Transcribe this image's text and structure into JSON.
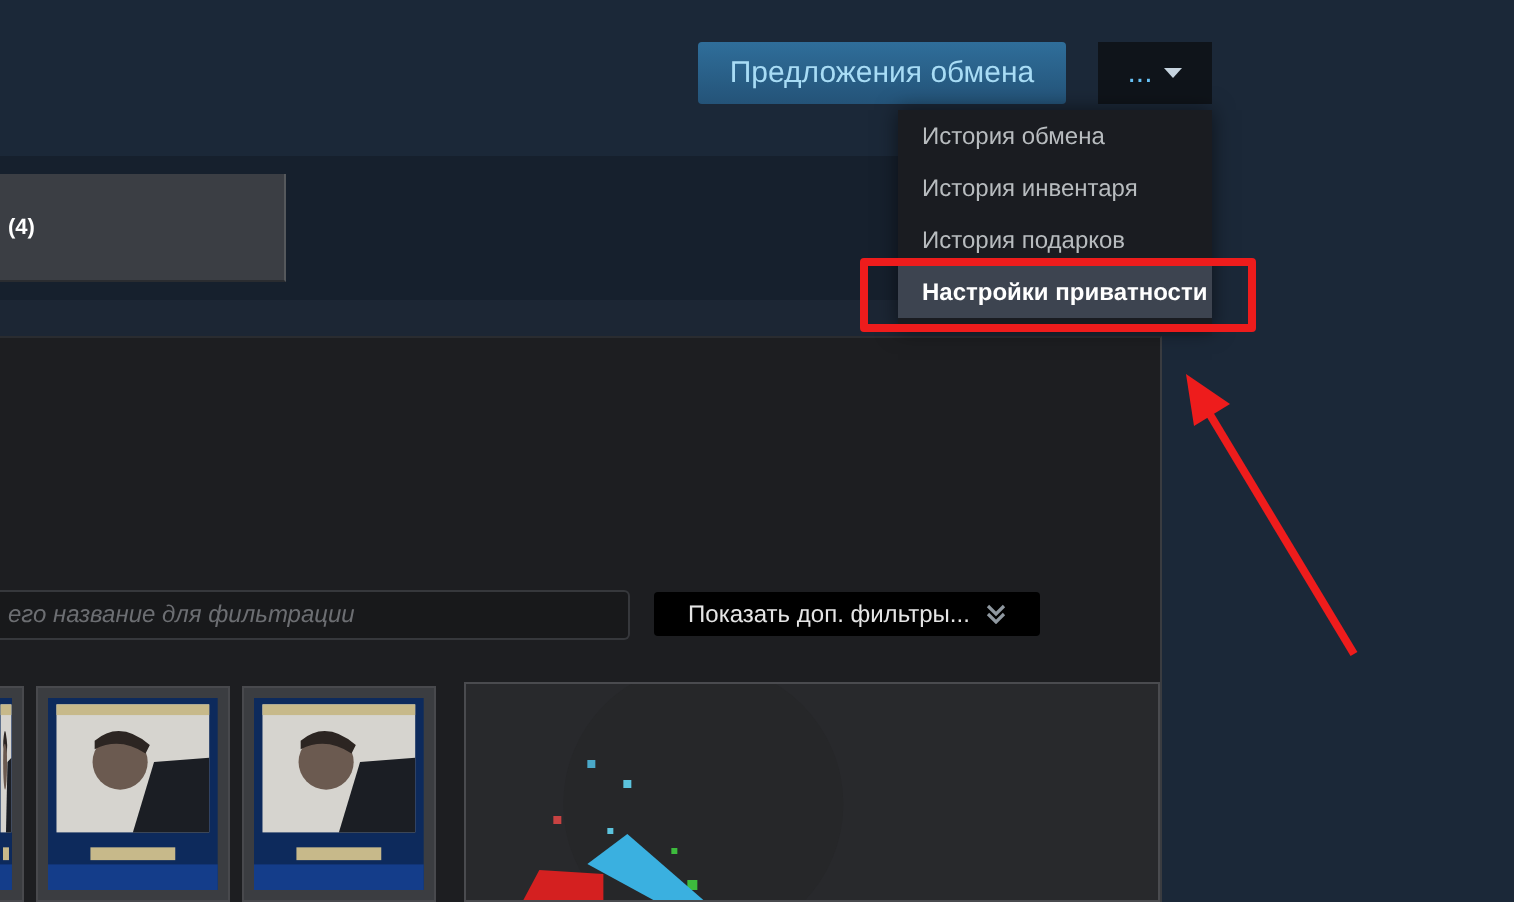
{
  "header": {
    "trade_button": "Предложения обмена",
    "more_button": "..."
  },
  "menu": [
    {
      "label": "История обмена",
      "selected": false
    },
    {
      "label": "История инвентаря",
      "selected": false
    },
    {
      "label": "История подарков",
      "selected": false
    },
    {
      "label": "Настройки приватности",
      "selected": true
    }
  ],
  "tab": {
    "label": "(4)"
  },
  "filter": {
    "placeholder": "его название для фильтрации",
    "button": "Показать доп. фильтры..."
  },
  "items": [
    {
      "kind": "card"
    },
    {
      "kind": "card"
    },
    {
      "kind": "card"
    }
  ]
}
